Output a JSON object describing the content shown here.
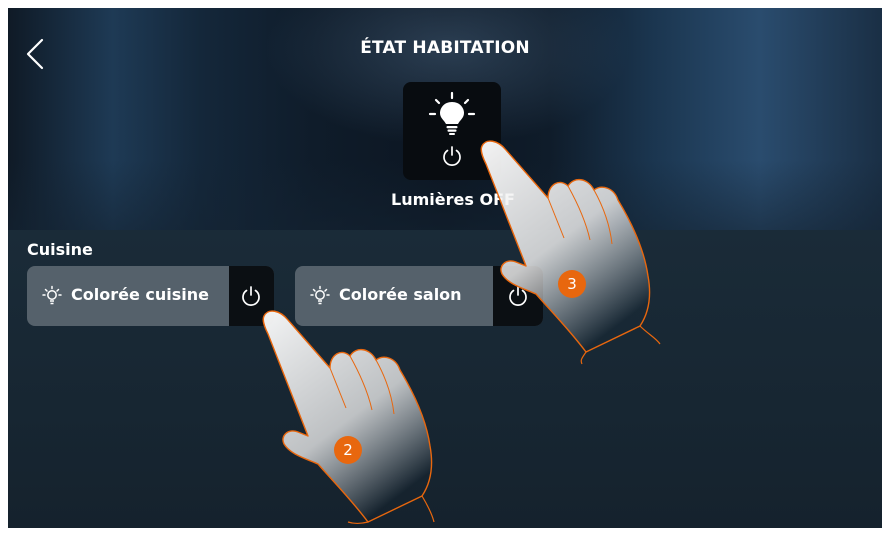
{
  "header": {
    "title": "ÉTAT HABITATION",
    "back_icon": "chevron-left-icon"
  },
  "global_lights": {
    "label": "Lumières OFF",
    "icon": "lightbulb-icon",
    "power_icon": "power-icon"
  },
  "section": {
    "title": "Cuisine"
  },
  "lights": [
    {
      "label": "Colorée cuisine",
      "icon": "light-bulb-small-icon",
      "power_icon": "power-icon"
    },
    {
      "label": "Colorée salon",
      "icon": "light-bulb-small-icon",
      "power_icon": "power-icon"
    }
  ],
  "annotations": {
    "step_a": "2",
    "step_b": "3"
  },
  "colors": {
    "badge": "#e8670e",
    "card": "#55616b",
    "tile": "#080c10"
  }
}
